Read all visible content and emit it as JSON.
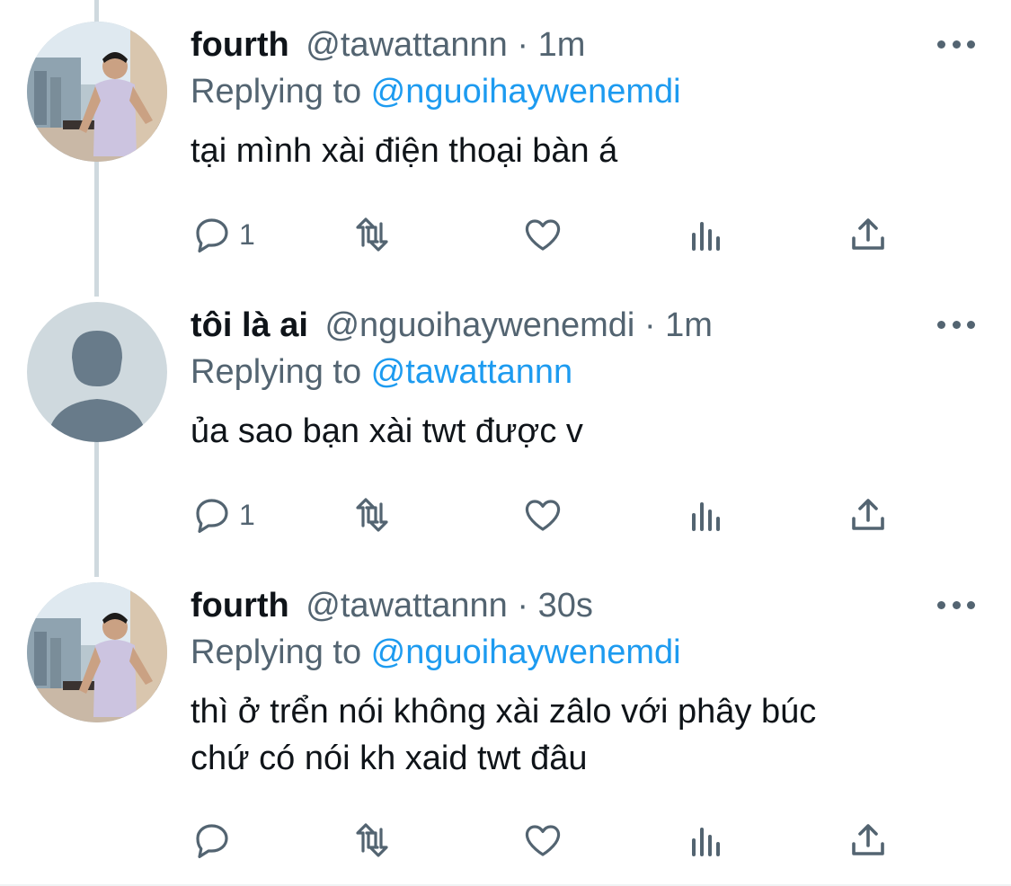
{
  "tweets": [
    {
      "display_name": "fourth",
      "handle": "@tawattannn",
      "separator": " · ",
      "time": "1m",
      "replying_prefix": "Replying to ",
      "replying_to": "@nguoihaywenemdi",
      "body": [
        "tại mình xài điện thoại bàn á"
      ],
      "reply_count": "1",
      "avatar": "photo-avatar"
    },
    {
      "display_name": "tôi là ai",
      "handle": "@nguoihaywenemdi",
      "separator": " · ",
      "time": "1m",
      "replying_prefix": "Replying to ",
      "replying_to": "@tawattannn",
      "body": [
        "ủa sao bạn xài twt được v"
      ],
      "reply_count": "1",
      "avatar": "default-avatar"
    },
    {
      "display_name": "fourth",
      "handle": "@tawattannn",
      "separator": " · ",
      "time": "30s",
      "replying_prefix": "Replying to ",
      "replying_to": "@nguoihaywenemdi",
      "body": [
        "thì ở trển nói không xài zâlo với phây búc",
        "chứ có nói kh xaid twt đâu"
      ],
      "reply_count": "",
      "avatar": "photo-avatar"
    }
  ],
  "icons": [
    "reply-icon",
    "retweet-icon",
    "like-icon",
    "views-icon",
    "share-icon",
    "more-icon"
  ],
  "colors": {
    "text": "#0f1419",
    "secondary": "#536471",
    "mention": "#1d9bf0",
    "thread_line": "#cfd9de",
    "default_avatar_bg": "#cfd9de",
    "default_avatar_fg": "#687b8a"
  }
}
